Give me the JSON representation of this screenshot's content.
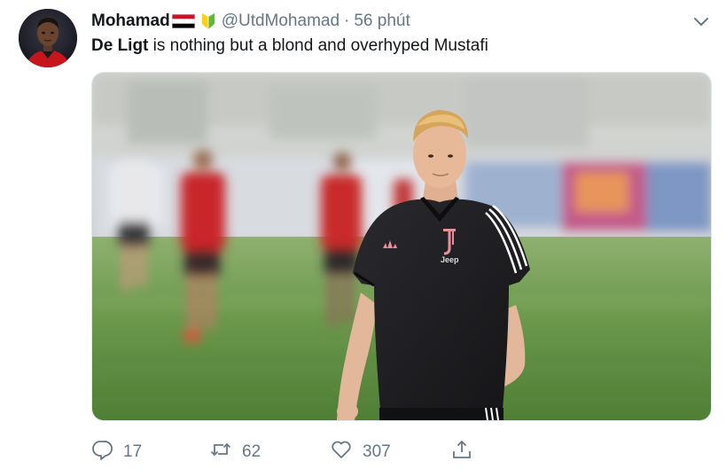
{
  "tweet": {
    "display_name": "Mohamad",
    "handle": "@UtdMohamad",
    "separator": "·",
    "time": "56 phút",
    "text_bold": "De Ligt",
    "text_rest": " is nothing but a blond and overhyped Mustafi",
    "icons": {
      "flag": "yemen-flag-icon",
      "badge": "beginner-badge-icon",
      "menu": "chevron-down-icon"
    },
    "media": {
      "alt": "footballer-in-black-training-shirt",
      "shirt_brand": "Jeep"
    },
    "actions": {
      "reply_count": "17",
      "retweet_count": "62",
      "like_count": "307"
    },
    "colors": {
      "text": "#14171a",
      "muted": "#657786",
      "border": "#e1e8ed"
    }
  }
}
